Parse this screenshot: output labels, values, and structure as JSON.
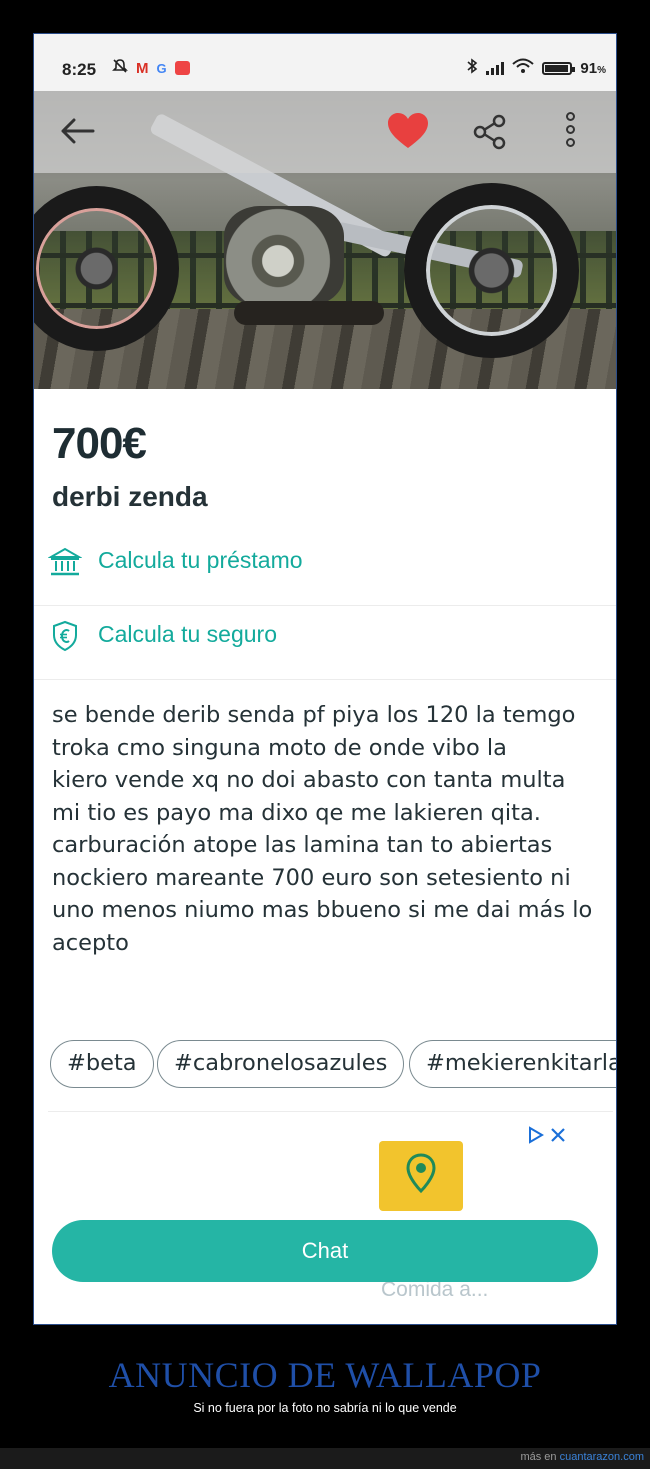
{
  "status_bar": {
    "time": "8:25",
    "battery": "91",
    "battery_unit": "%",
    "left_icons": [
      "muted-alarm-icon",
      "gmail-icon",
      "google-icon",
      "app-notification-icon"
    ],
    "right_icons": [
      "bluetooth-icon",
      "signal-icon",
      "wifi-icon",
      "battery-icon"
    ]
  },
  "listing": {
    "price": "700€",
    "title": "derbi zenda",
    "loan_label": "Calcula tu préstamo",
    "insurance_label": "Calcula tu seguro",
    "description": "se bende derib senda pf piya los 120 la temgo\ntroka cmo singuna moto de onde vibo la\nkiero vende xq no doi abasto con tanta multa\nmi tio es payo ma dixo qe me lakieren qita.\ncarburación atope las lamina tan to abiertas\nnockiero mareante 700 euro son setesiento ni\nuno menos niumo mas bbueno si me dai más lo\nacepto",
    "tags": [
      "#beta",
      "#cabronelosazules",
      "#mekierenkitarla"
    ],
    "favorite": true
  },
  "ad": {
    "caption": "Comida a..."
  },
  "actions": {
    "chat_label": "Chat"
  },
  "footer": {
    "headline": "ANUNCIO DE WALLAPOP",
    "subline": "Si no fuera por la foto no sabría ni lo que vende",
    "credit_prefix": "más en ",
    "credit_site": "cuantarazon.com"
  },
  "colors": {
    "accent": "#13aa9c",
    "chat_button": "#25b5a5",
    "heart": "#e8403f",
    "headline": "#1f4fa8"
  }
}
